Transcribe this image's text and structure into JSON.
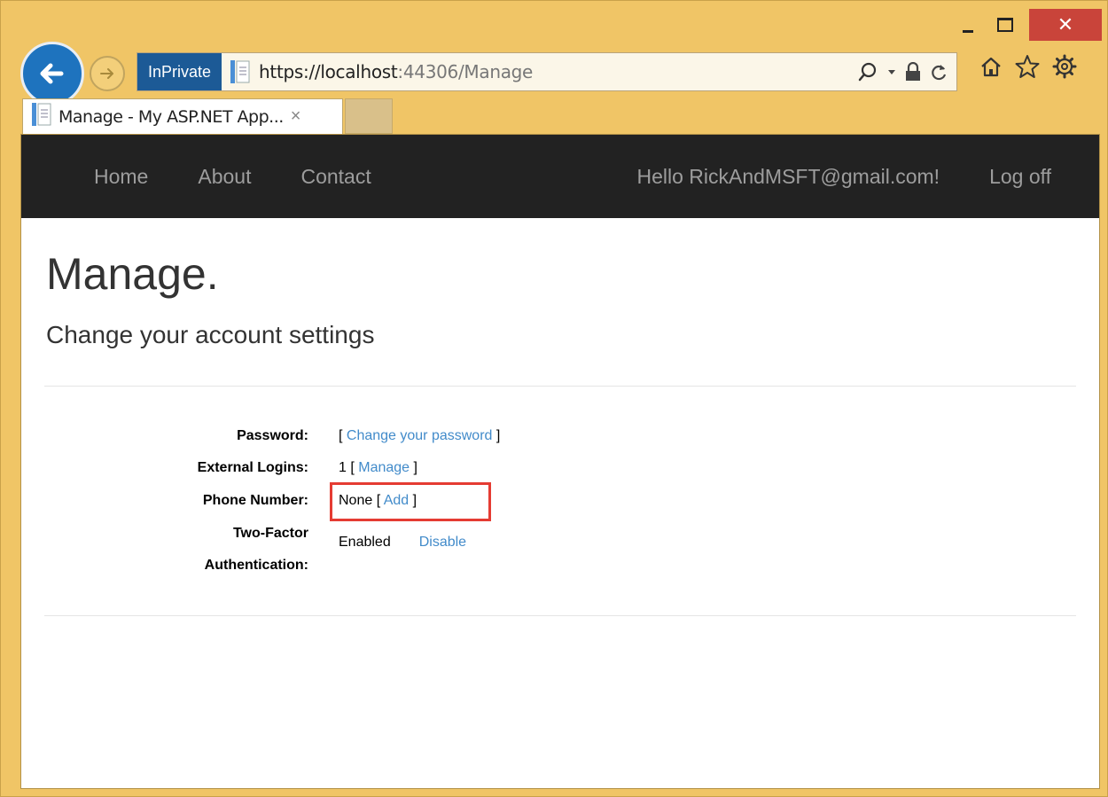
{
  "browser": {
    "inprivate_label": "InPrivate",
    "url_host": "https://localhost",
    "url_path": ":44306/Manage",
    "tab_title": "Manage - My ASP.NET App...",
    "tab_close": "×",
    "close_glyph": "✕",
    "icons": [
      "back-arrow-icon",
      "forward-arrow-icon",
      "page-icon",
      "search-icon",
      "dropdown-icon",
      "lock-icon",
      "refresh-icon",
      "home-icon",
      "favorites-star-icon",
      "settings-gear-icon"
    ]
  },
  "navbar": {
    "home": "Home",
    "about": "About",
    "contact": "Contact",
    "hello": "Hello RickAndMSFT@gmail.com!",
    "logoff": "Log off"
  },
  "page": {
    "title": "Manage.",
    "subtitle": "Change your account settings"
  },
  "settings": {
    "password_label": "Password:",
    "password_open": "[ ",
    "password_link": "Change your password",
    "password_close": " ]",
    "logins_label": "External Logins:",
    "logins_prefix": "1 [ ",
    "logins_link": "Manage",
    "logins_close": " ]",
    "phone_label": "Phone Number:",
    "phone_prefix": "None [ ",
    "phone_link": "Add",
    "phone_close": " ]",
    "twofactor_label_1": "Two-Factor",
    "twofactor_label_2": "Authentication:",
    "twofactor_status": "Enabled",
    "twofactor_link": "Disable"
  },
  "colors": {
    "frame": "#f0c566",
    "navbar": "#222222",
    "link": "#428bca",
    "highlight": "#e53c33"
  }
}
